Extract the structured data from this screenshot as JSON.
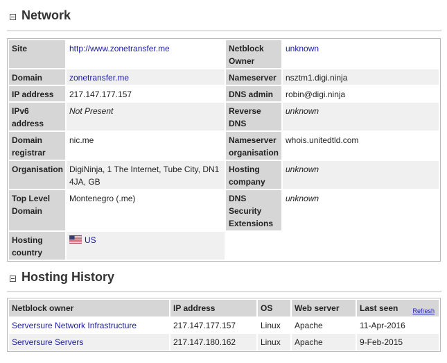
{
  "network": {
    "title": "Network",
    "rows_left": [
      {
        "label": "Site",
        "value": "http://www.zonetransfer.me",
        "kind": "link"
      },
      {
        "label": "Domain",
        "value": "zonetransfer.me",
        "kind": "link"
      },
      {
        "label": "IP address",
        "value": "217.147.177.157",
        "kind": "text"
      },
      {
        "label": "IPv6 address",
        "value": "Not Present",
        "kind": "italic"
      },
      {
        "label": "Domain registrar",
        "value": "nic.me",
        "kind": "text"
      },
      {
        "label": "Organisation",
        "value": "DigiNinja, 1 The Internet, Tube City, DN1 4JA, GB",
        "kind": "text"
      },
      {
        "label": "Top Level Domain",
        "value": "Montenegro (.me)",
        "kind": "text"
      },
      {
        "label": "Hosting country",
        "value": "US",
        "kind": "flag-link",
        "icon": "us-flag-icon"
      }
    ],
    "rows_right": [
      {
        "label": "Netblock Owner",
        "value": "unknown",
        "kind": "link"
      },
      {
        "label": "Nameserver",
        "value": "nsztm1.digi.ninja",
        "kind": "text"
      },
      {
        "label": "DNS admin",
        "value": "robin@digi.ninja",
        "kind": "text"
      },
      {
        "label": "Reverse DNS",
        "value": "unknown",
        "kind": "italic"
      },
      {
        "label": "Nameserver organisation",
        "value": "whois.unitedtld.com",
        "kind": "text"
      },
      {
        "label": "Hosting company",
        "value": "unknown",
        "kind": "italic"
      },
      {
        "label": "DNS Security Extensions",
        "value": "unknown",
        "kind": "italic"
      }
    ]
  },
  "history": {
    "title": "Hosting History",
    "refresh_label": "Refresh",
    "columns": [
      "Netblock owner",
      "IP address",
      "OS",
      "Web server",
      "Last seen"
    ],
    "rows": [
      {
        "owner": "Serversure Network Infrastructure",
        "ip": "217.147.177.157",
        "os": "Linux",
        "server": "Apache",
        "last_seen": "11-Apr-2016"
      },
      {
        "owner": "Serversure Servers",
        "ip": "217.147.180.162",
        "os": "Linux",
        "server": "Apache",
        "last_seen": "9-Feb-2015"
      }
    ]
  },
  "colors": {
    "label_bg": "#d6d6d6",
    "row_shade": "#f0f0f0",
    "link": "#1a1aa6"
  }
}
